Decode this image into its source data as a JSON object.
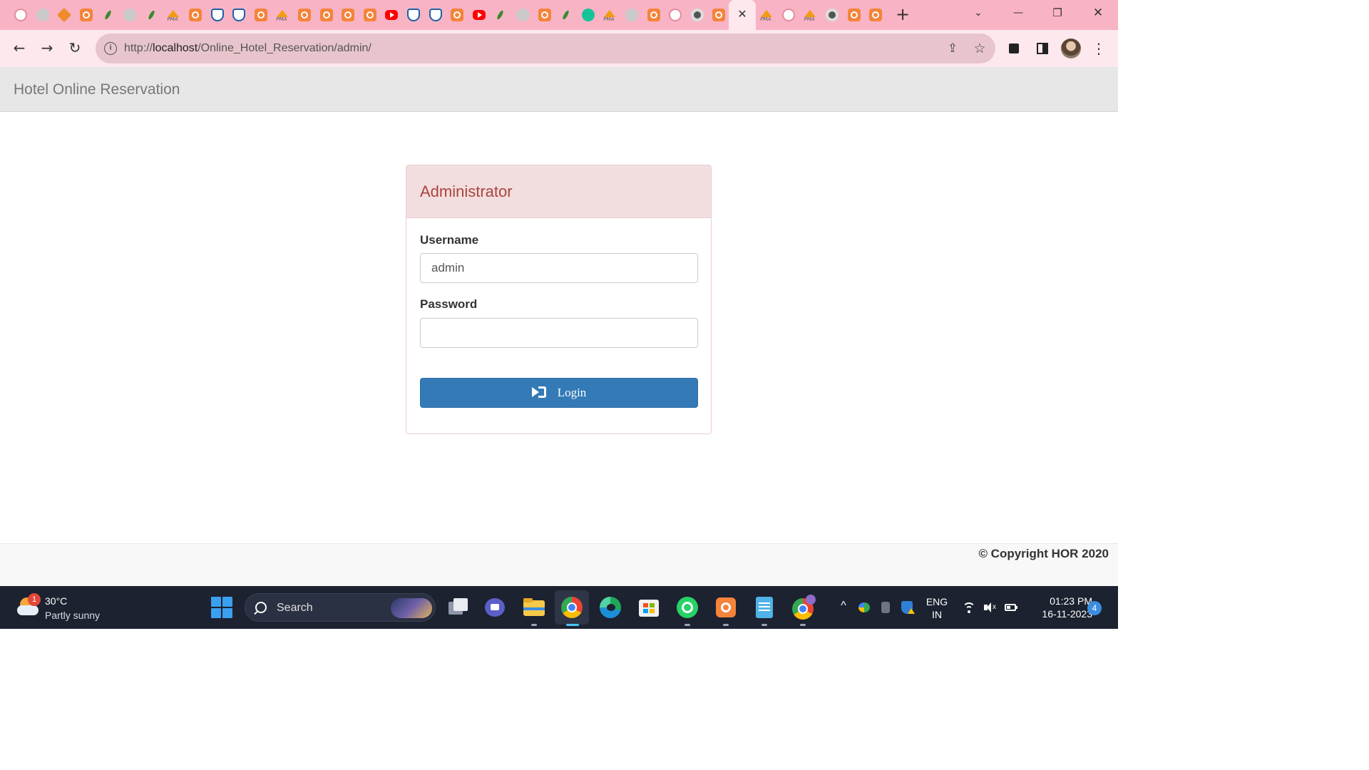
{
  "browser": {
    "tab_favicons": [
      "github-icon",
      "grey-circle-icon",
      "orange-diamond-icon",
      "xampp-icon",
      "leaf-icon",
      "grey-circle-icon",
      "leaf-icon",
      "phpmyadmin-icon",
      "xampp-icon",
      "shield-icon",
      "shield-icon",
      "xampp-icon",
      "phpmyadmin-icon",
      "xampp-icon",
      "xampp-icon",
      "xampp-icon",
      "xampp-icon",
      "youtube-icon",
      "shield-icon",
      "shield-icon",
      "xampp-icon",
      "youtube-icon",
      "leaf-icon",
      "grey-circle-icon",
      "xampp-icon",
      "leaf-icon",
      "grammarly-icon",
      "phpmyadmin-icon",
      "grey-circle-icon",
      "xampp-icon",
      "github-icon",
      "chrome-icon",
      "xampp-icon"
    ],
    "tab_favicons_right": [
      "phpmyadmin-icon",
      "github-icon",
      "phpmyadmin-icon",
      "chrome-icon",
      "xampp-icon",
      "xampp-icon"
    ],
    "active_tab_close": "✕",
    "new_tab": "+",
    "tab_search": "⌄",
    "window_minimize": "—",
    "window_maximize": "❐",
    "window_close": "✕",
    "nav_back": "←",
    "nav_forward": "→",
    "nav_reload": "↻",
    "url_prefix": "http://",
    "url_host": "localhost",
    "url_path": "/Online_Hotel_Reservation/admin/",
    "share_glyph": "⇪",
    "star_glyph": "☆",
    "menu_glyph": "⋮",
    "tab_strip_color": "#f8b4c4",
    "toolbar_color": "#fde8ee"
  },
  "page": {
    "brand": "Hotel Online Reservation",
    "panel_title": "Administrator",
    "username_label": "Username",
    "username_value": "admin",
    "password_label": "Password",
    "password_value": "",
    "login_label": "Login",
    "copyright": "© Copyright HOR 2020",
    "primary_color": "#337ab7",
    "danger_heading_color": "#a94442"
  },
  "taskbar": {
    "weather_temp": "30°C",
    "weather_desc": "Partly sunny",
    "weather_badge": "1",
    "search_label": "Search",
    "apps": [
      "task-view-icon",
      "teams-icon",
      "file-explorer-icon",
      "chrome-icon",
      "edge-icon",
      "microsoft-store-icon",
      "whatsapp-icon",
      "xampp-icon",
      "notepad-icon",
      "chrome-profile-icon"
    ],
    "tray_chevron": "^",
    "lang_primary": "ENG",
    "lang_secondary": "IN",
    "time": "01:23 PM",
    "date": "16-11-2023",
    "notification_count": "4"
  }
}
